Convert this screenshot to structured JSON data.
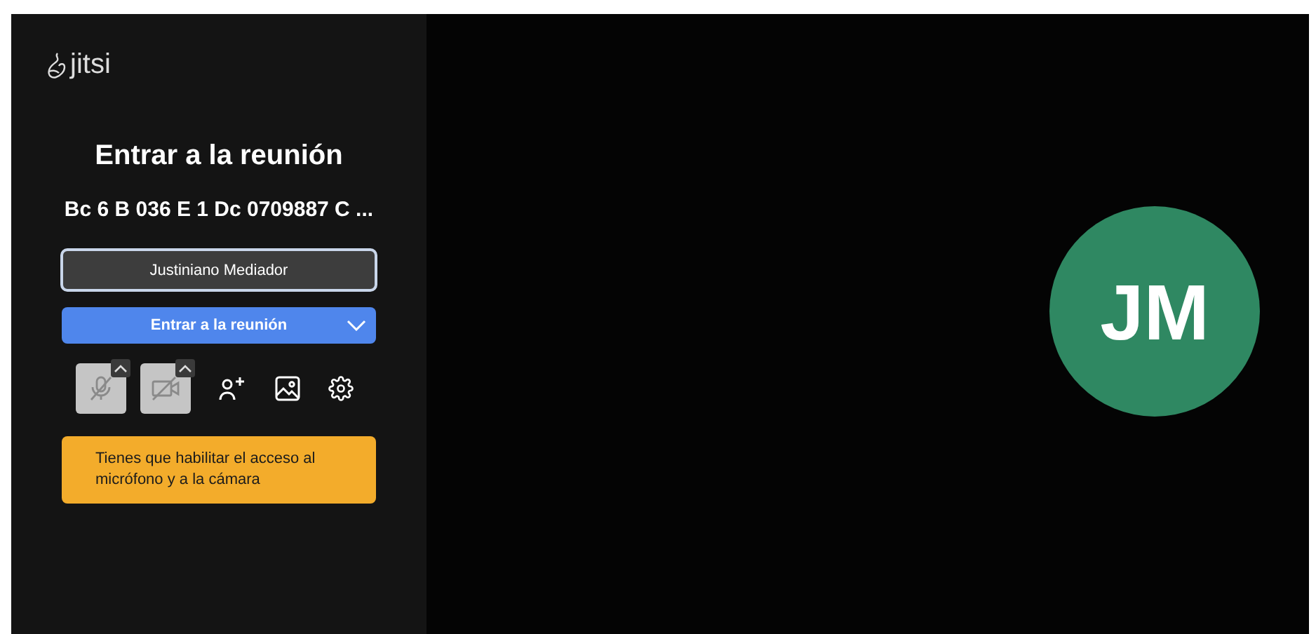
{
  "logo": {
    "text": "jitsi"
  },
  "prejoin": {
    "title": "Entrar a la reunión",
    "meeting_name": "Bc 6 B 036 E 1 Dc 0709887 C ...",
    "name_field": {
      "value": "Justiniano Mediador"
    },
    "join_button": {
      "label": "Entrar a la reunión"
    },
    "toolbar": [
      {
        "kind": "mic",
        "disabled": true
      },
      {
        "kind": "camera",
        "disabled": true
      },
      {
        "kind": "invite"
      },
      {
        "kind": "background"
      },
      {
        "kind": "settings"
      }
    ],
    "warning": "Tienes que habilitar el acceso al micrófono y a la cámara"
  },
  "preview": {
    "avatar_initials": "JM"
  }
}
